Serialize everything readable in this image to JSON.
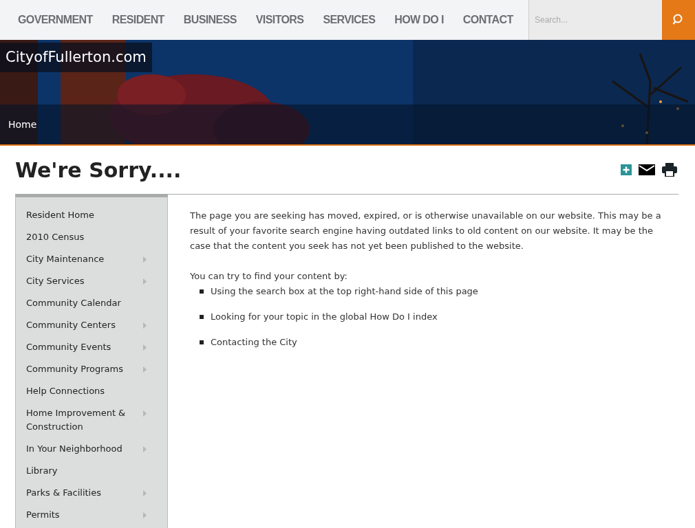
{
  "nav": {
    "items": [
      {
        "label": "GOVERNMENT"
      },
      {
        "label": "RESIDENT"
      },
      {
        "label": "BUSINESS"
      },
      {
        "label": "VISITORS"
      },
      {
        "label": "SERVICES"
      },
      {
        "label": "HOW DO I"
      },
      {
        "label": "CONTACT"
      }
    ],
    "search": {
      "placeholder": "Search..."
    }
  },
  "banner": {
    "site_title": "CityofFullerton.com",
    "breadcrumb": [
      "Home"
    ]
  },
  "page_title": "We're Sorry....",
  "sidebar": {
    "items": [
      {
        "label": "Resident Home",
        "expandable": false
      },
      {
        "label": "2010 Census",
        "expandable": false
      },
      {
        "label": "City Maintenance",
        "expandable": true
      },
      {
        "label": "City Services",
        "expandable": true
      },
      {
        "label": "Community Calendar",
        "expandable": false
      },
      {
        "label": "Community Centers",
        "expandable": true
      },
      {
        "label": "Community Events",
        "expandable": true
      },
      {
        "label": "Community Programs",
        "expandable": true
      },
      {
        "label": "Help Connections",
        "expandable": false
      },
      {
        "label": "Home Improvement & Construction",
        "expandable": true
      },
      {
        "label": "In Your Neighborhood",
        "expandable": true
      },
      {
        "label": "Library",
        "expandable": false
      },
      {
        "label": "Parks & Facilities",
        "expandable": true
      },
      {
        "label": "Permits",
        "expandable": true
      }
    ]
  },
  "content": {
    "paragraph": "The page you are seeking has moved, expired, or is otherwise unavailable on our website. This may be a result of your favorite search engine having outdated links to old content on our website. It may be the case that the content you seek has not yet been published to the website.",
    "intro": "You can try to find your content by:",
    "bullets": [
      "Using the search box at the top right-hand side of this page",
      "Looking for your topic in the global How Do I index",
      "Contacting the City"
    ]
  }
}
